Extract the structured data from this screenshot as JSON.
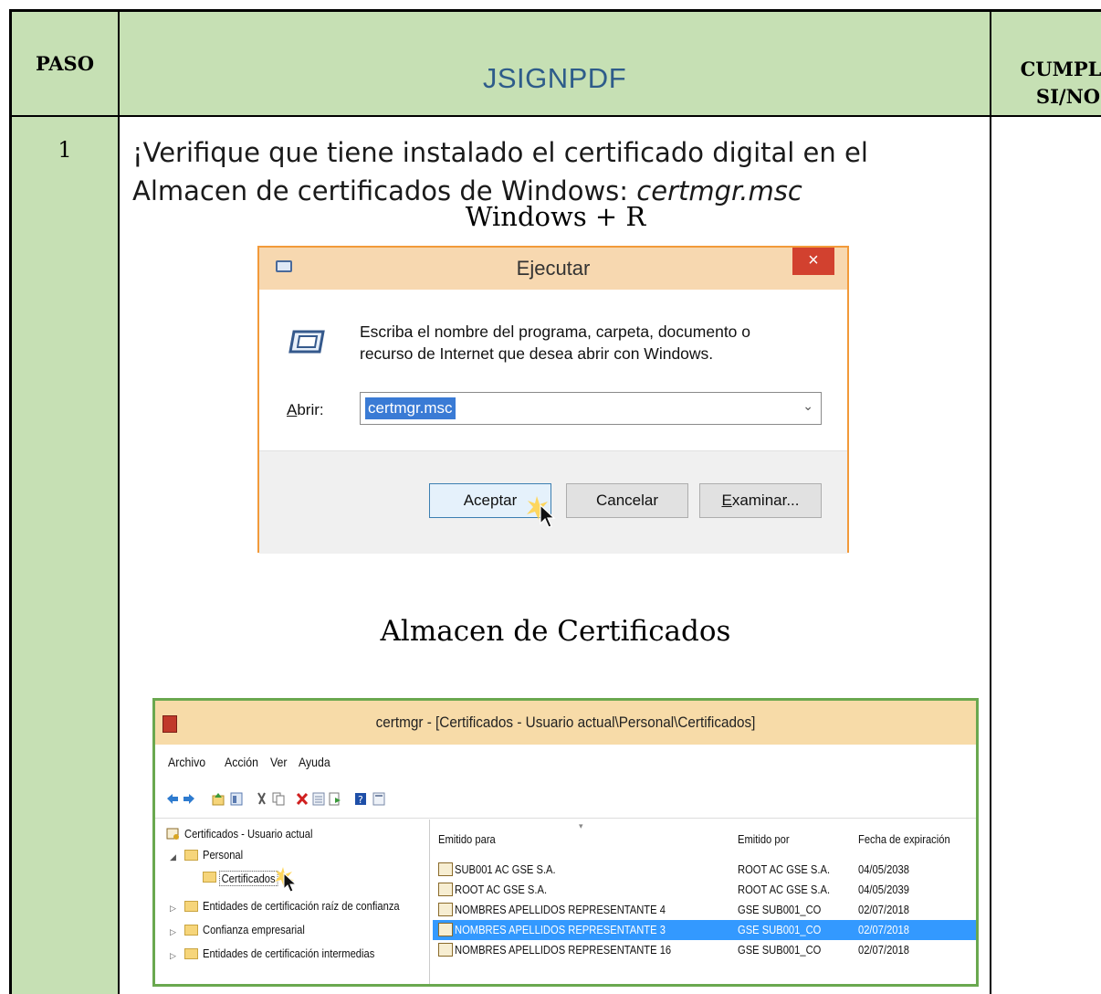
{
  "header": {
    "paso": "PASO",
    "title": "JSIGNPDF",
    "cumple_line1": "CUMPLE",
    "cumple_line2": "SI/NO"
  },
  "step": {
    "number": "1",
    "instruction_line1": "¡Verifique que tiene instalado el certificado digital en el",
    "instruction_line2_text": "Almacen de certificados de Windows: ",
    "instruction_line2_cmd": "certmgr.msc",
    "shortcut": "Windows + R",
    "section_label": "Almacen de Certificados"
  },
  "run_dialog": {
    "title": "Ejecutar",
    "close": "×",
    "message_line1": "Escriba el nombre del programa, carpeta, documento o",
    "message_line2": "recurso de Internet que desea abrir con Windows.",
    "open_label_underlined": "A",
    "open_label_rest": "brir:",
    "input_value": "certmgr.msc",
    "accept_button": "Aceptar",
    "cancel_button": "Cancelar",
    "browse_button_underlined": "E",
    "browse_button_rest": "xaminar..."
  },
  "certmgr": {
    "title": "certmgr - [Certificados - Usuario actual\\Personal\\Certificados]",
    "menu": [
      "Archivo",
      "Acción",
      "Ver",
      "Ayuda"
    ],
    "tree": [
      "Certificados - Usuario actual",
      "Personal",
      "Certificados",
      "Entidades de certificación raíz de confianza",
      "Confianza empresarial",
      "Entidades de certificación intermedias"
    ],
    "columns": [
      "Emitido para",
      "Emitido por",
      "Fecha de expiración"
    ],
    "rows": [
      {
        "to": "SUB001 AC GSE S.A.",
        "by": "ROOT AC GSE S.A.",
        "exp": "04/05/2038"
      },
      {
        "to": "ROOT AC GSE S.A.",
        "by": "ROOT AC GSE S.A.",
        "exp": "04/05/2039"
      },
      {
        "to": "NOMBRES APELLIDOS REPRESENTANTE 4",
        "by": "GSE SUB001_CO",
        "exp": "02/07/2018"
      },
      {
        "to": "NOMBRES APELLIDOS REPRESENTANTE 3",
        "by": "GSE SUB001_CO",
        "exp": "02/07/2018"
      },
      {
        "to": "NOMBRES APELLIDOS REPRESENTANTE 16",
        "by": "GSE SUB001_CO",
        "exp": "02/07/2018"
      }
    ],
    "selected_row_index": 3,
    "colors": {
      "title_bar": "#f7dba8",
      "selection": "#3399ff",
      "frame": "#6aa84f"
    }
  },
  "colors": {
    "header_bg": "#c6e0b4",
    "title_text": "#2e5c8a",
    "dialog_border": "#f29a3a"
  }
}
